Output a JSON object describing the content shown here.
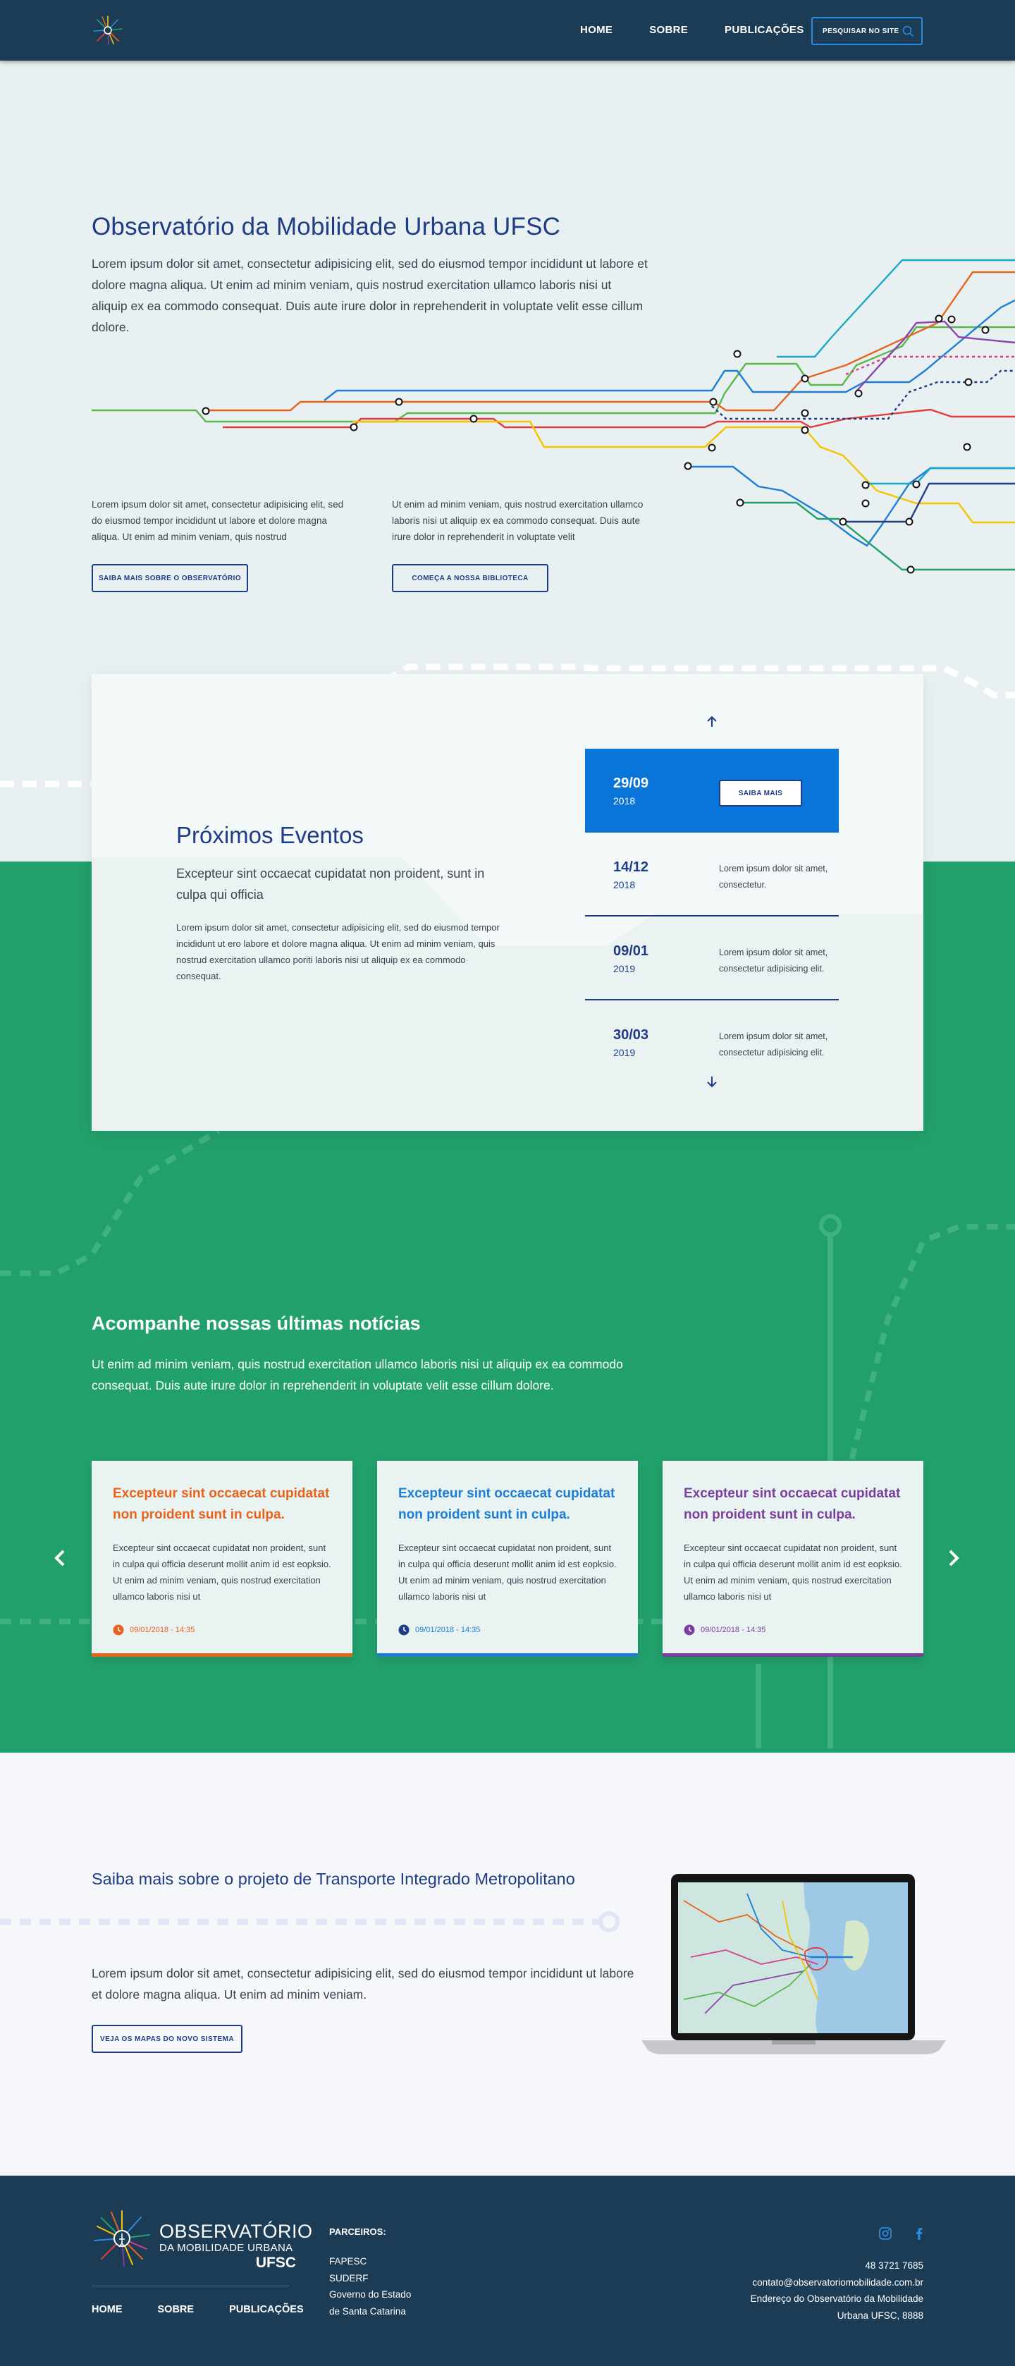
{
  "header": {
    "nav": [
      "HOME",
      "SOBRE",
      "PUBLICAÇÕES"
    ],
    "search_label": "PESQUISAR NO SITE"
  },
  "hero": {
    "title": "Observatório da Mobilidade Urbana UFSC",
    "lead": "Lorem ipsum dolor sit amet, consectetur adipisicing elit, sed do eiusmod tempor incididunt ut labore et dolore magna aliqua. Ut enim ad minim veniam, quis nostrud exercitation ullamco laboris nisi ut aliquip ex ea commodo consequat. Duis aute irure dolor in reprehenderit in voluptate velit esse cillum dolore.",
    "col1_text": "Lorem ipsum dolor sit amet, consectetur adipisicing elit, sed do eiusmod tempor incididunt ut labore et dolore magna aliqua. Ut enim ad minim veniam, quis nostrud",
    "col1_button": "SAIBA MAIS SOBRE O OBSERVATÓRIO",
    "col2_text": "Ut enim ad minim veniam, quis nostrud exercitation ullamco laboris nisi ut aliquip ex ea commodo consequat. Duis aute irure dolor in reprehenderit in voluptate velit",
    "col2_button": "COMEÇA A NOSSA BIBLIOTECA"
  },
  "events": {
    "title": "Próximos Eventos",
    "subtitle": "Excepteur sint occaecat cupidatat non proident, sunt in culpa qui officia",
    "body": "Lorem ipsum dolor sit amet, consectetur adipisicing elit, sed do eiusmod tempor incididunt ut ero labore et dolore magna aliqua. Ut enim ad minim veniam, quis nostrud exercitation ullamco poriti laboris nisi ut aliquip ex ea commodo consequat.",
    "items": [
      {
        "date": "29/09",
        "year": "2018",
        "button": "SAIBA MAIS"
      },
      {
        "date": "14/12",
        "year": "2018",
        "text": "Lorem ipsum dolor sit amet, consectetur."
      },
      {
        "date": "09/01",
        "year": "2019",
        "text": "Lorem ipsum dolor sit amet, consectetur adipisicing elit."
      },
      {
        "date": "30/03",
        "year": "2019",
        "text": "Lorem ipsum dolor sit amet, consectetur adipisicing elit."
      }
    ]
  },
  "news": {
    "title": "Acompanhe nossas últimas notícias",
    "lead": "Ut enim ad minim veniam, quis nostrud exercitation ullamco laboris nisi ut aliquip ex ea commodo consequat. Duis aute irure dolor in reprehenderit in voluptate velit esse cillum dolore.",
    "cards": [
      {
        "title": "Excepteur sint occaecat cupidatat non proident sunt in culpa.",
        "text": "Excepteur sint occaecat cupidatat non proident, sunt in culpa qui officia deserunt mollit anim id est eopksio. Ut enim ad minim veniam, quis nostrud exercitation ullamco laboris nisi ut",
        "date": "09/01/2018 - 14:35",
        "color": "#e8641d"
      },
      {
        "title": "Excepteur sint occaecat cupidatat non proident sunt in culpa.",
        "text": "Excepteur sint occaecat cupidatat non proident, sunt in culpa qui officia deserunt mollit anim id est eopksio. Ut enim ad minim veniam, quis nostrud exercitation ullamco laboris nisi ut",
        "date": "09/01/2018 - 14:35",
        "color": "#1c7ed6"
      },
      {
        "title": "Excepteur sint occaecat cupidatat non proident sunt in culpa.",
        "text": "Excepteur sint occaecat cupidatat non proident, sunt in culpa qui officia deserunt mollit anim id est eopksio. Ut enim ad minim veniam, quis nostrud exercitation ullamco laboris nisi ut",
        "date": "09/01/2018 - 14:35",
        "color": "#7b3fa0"
      }
    ]
  },
  "tim": {
    "title": "Saiba mais sobre o projeto de Transporte Integrado Metropolitano",
    "text": "Lorem ipsum dolor sit amet, consectetur adipisicing elit, sed do eiusmod tempor incididunt ut labore et dolore magna aliqua. Ut enim ad minim veniam.",
    "button": "VEJA OS MAPAS DO NOVO SISTEMA"
  },
  "footer": {
    "logo_line1": "OBSERVATÓRIO",
    "logo_line2": "DA MOBILIDADE URBANA",
    "logo_line3": "UFSC",
    "nav": [
      "HOME",
      "SOBRE",
      "PUBLICAÇÕES"
    ],
    "partners_title": "PARCEIROS:",
    "partners": [
      "FAPESC",
      "SUDERF",
      "Governo do Estado",
      "de Santa Catarina"
    ],
    "phone": "48 3721 7685",
    "email": "contato@observatoriomobilidade.com.br",
    "address_line1": "Endereço do Observatório da Mobilidade",
    "address_line2": "Urbana UFSC, 8888"
  },
  "colors": {
    "navy": "#1c3c55",
    "blue_text": "#1f3d86",
    "accent_blue": "#0a75d9",
    "green": "#22a06b",
    "hero_bg": "#e8f0f1"
  }
}
